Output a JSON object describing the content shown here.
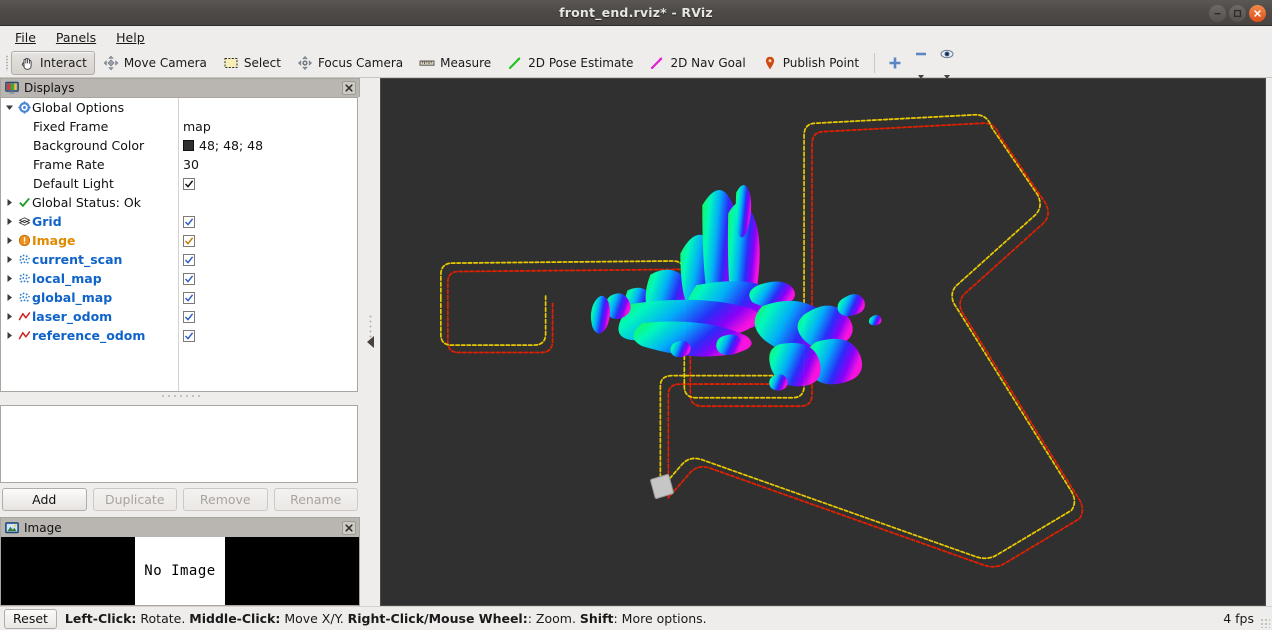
{
  "window": {
    "title": "front_end.rviz* - RViz",
    "controls": {
      "minimize": "minimize-button",
      "maximize": "maximize-button",
      "close": "close-button"
    }
  },
  "menubar": {
    "items": [
      {
        "label": "File",
        "mnemonic": "F"
      },
      {
        "label": "Panels",
        "mnemonic": "P"
      },
      {
        "label": "Help",
        "mnemonic": "H"
      }
    ]
  },
  "toolbar": {
    "tools": [
      {
        "label": "Interact",
        "icon": "hand-cursor-icon",
        "active": true
      },
      {
        "label": "Move Camera",
        "icon": "move-camera-icon",
        "active": false
      },
      {
        "label": "Select",
        "icon": "select-rect-icon",
        "active": false
      },
      {
        "label": "Focus Camera",
        "icon": "focus-camera-icon",
        "active": false
      },
      {
        "label": "Measure",
        "icon": "ruler-icon",
        "active": false
      },
      {
        "label": "2D Pose Estimate",
        "icon": "green-arrow-icon",
        "active": false
      },
      {
        "label": "2D Nav Goal",
        "icon": "magenta-arrow-icon",
        "active": false
      },
      {
        "label": "Publish Point",
        "icon": "map-pin-icon",
        "active": false
      }
    ],
    "extra": [
      {
        "icon": "plus-icon",
        "label": ""
      },
      {
        "icon": "minus-icon",
        "label": ""
      },
      {
        "icon": "eye-icon",
        "label": ""
      }
    ]
  },
  "displays_panel": {
    "title": "Displays",
    "icon": "displays-panel-icon",
    "close_label": "✕",
    "rows": [
      {
        "type": "group",
        "label": "Global Options",
        "icon": "gear-icon",
        "expanded": true,
        "indent": 0,
        "style": "plain",
        "value_type": "none"
      },
      {
        "type": "prop",
        "label": "Fixed Frame",
        "indent": 1,
        "style": "plain",
        "value_type": "text",
        "value": "map"
      },
      {
        "type": "prop",
        "label": "Background Color",
        "indent": 1,
        "style": "plain",
        "value_type": "color",
        "value": "48; 48; 48",
        "color_hex": "#303030"
      },
      {
        "type": "prop",
        "label": "Frame Rate",
        "indent": 1,
        "style": "plain",
        "value_type": "text",
        "value": "30"
      },
      {
        "type": "prop",
        "label": "Default Light",
        "indent": 1,
        "style": "plain",
        "value_type": "check",
        "checked": true
      },
      {
        "type": "group",
        "label": "Global Status: Ok",
        "icon": "green-check-icon",
        "expanded": false,
        "indent": 0,
        "style": "plain",
        "value_type": "none"
      },
      {
        "type": "display",
        "label": "Grid",
        "icon": "grid-icon",
        "expanded": false,
        "indent": 0,
        "style": "blue",
        "value_type": "check",
        "checked": true
      },
      {
        "type": "display",
        "label": "Image",
        "icon": "warning-icon",
        "expanded": false,
        "indent": 0,
        "style": "orange",
        "value_type": "check",
        "checked": true
      },
      {
        "type": "display",
        "label": "current_scan",
        "icon": "pointcloud-icon",
        "expanded": false,
        "indent": 0,
        "style": "blue",
        "value_type": "check",
        "checked": true
      },
      {
        "type": "display",
        "label": "local_map",
        "icon": "pointcloud-icon",
        "expanded": false,
        "indent": 0,
        "style": "blue",
        "value_type": "check",
        "checked": true
      },
      {
        "type": "display",
        "label": "global_map",
        "icon": "pointcloud-icon",
        "expanded": false,
        "indent": 0,
        "style": "blue",
        "value_type": "check",
        "checked": true
      },
      {
        "type": "display",
        "label": "laser_odom",
        "icon": "path-icon",
        "expanded": false,
        "indent": 0,
        "style": "blue",
        "value_type": "check",
        "checked": true
      },
      {
        "type": "display",
        "label": "reference_odom",
        "icon": "path-icon",
        "expanded": false,
        "indent": 0,
        "style": "blue",
        "value_type": "check",
        "checked": true
      }
    ],
    "buttons": [
      {
        "label": "Add",
        "enabled": true
      },
      {
        "label": "Duplicate",
        "enabled": false
      },
      {
        "label": "Remove",
        "enabled": false
      },
      {
        "label": "Rename",
        "enabled": false
      }
    ]
  },
  "image_panel": {
    "title": "Image",
    "icon": "image-panel-icon",
    "close_label": "✕",
    "placeholder": "No Image"
  },
  "view3d": {
    "background_hex": "#303030",
    "path_laser_odom_hex": "#e8c800",
    "path_reference_odom_hex": "#e02000",
    "robot_marker_hex": "#c8c8c8",
    "scan_colors": [
      "#00ff44",
      "#00ffcc",
      "#00c8ff",
      "#0044ff",
      "#7a00ff",
      "#ff00e0"
    ],
    "collapse_arrow": "collapse-left-arrow-icon"
  },
  "statusbar": {
    "reset_label": "Reset",
    "hint_parts": [
      {
        "text": "Left-Click:",
        "bold": true
      },
      {
        "text": " Rotate. ",
        "bold": false
      },
      {
        "text": "Middle-Click:",
        "bold": true
      },
      {
        "text": " Move X/Y. ",
        "bold": false
      },
      {
        "text": "Right-Click/Mouse Wheel:",
        "bold": true
      },
      {
        "text": ": Zoom. ",
        "bold": false
      },
      {
        "text": "Shift",
        "bold": true
      },
      {
        "text": ": More options.",
        "bold": false
      }
    ],
    "fps": "4 fps"
  }
}
